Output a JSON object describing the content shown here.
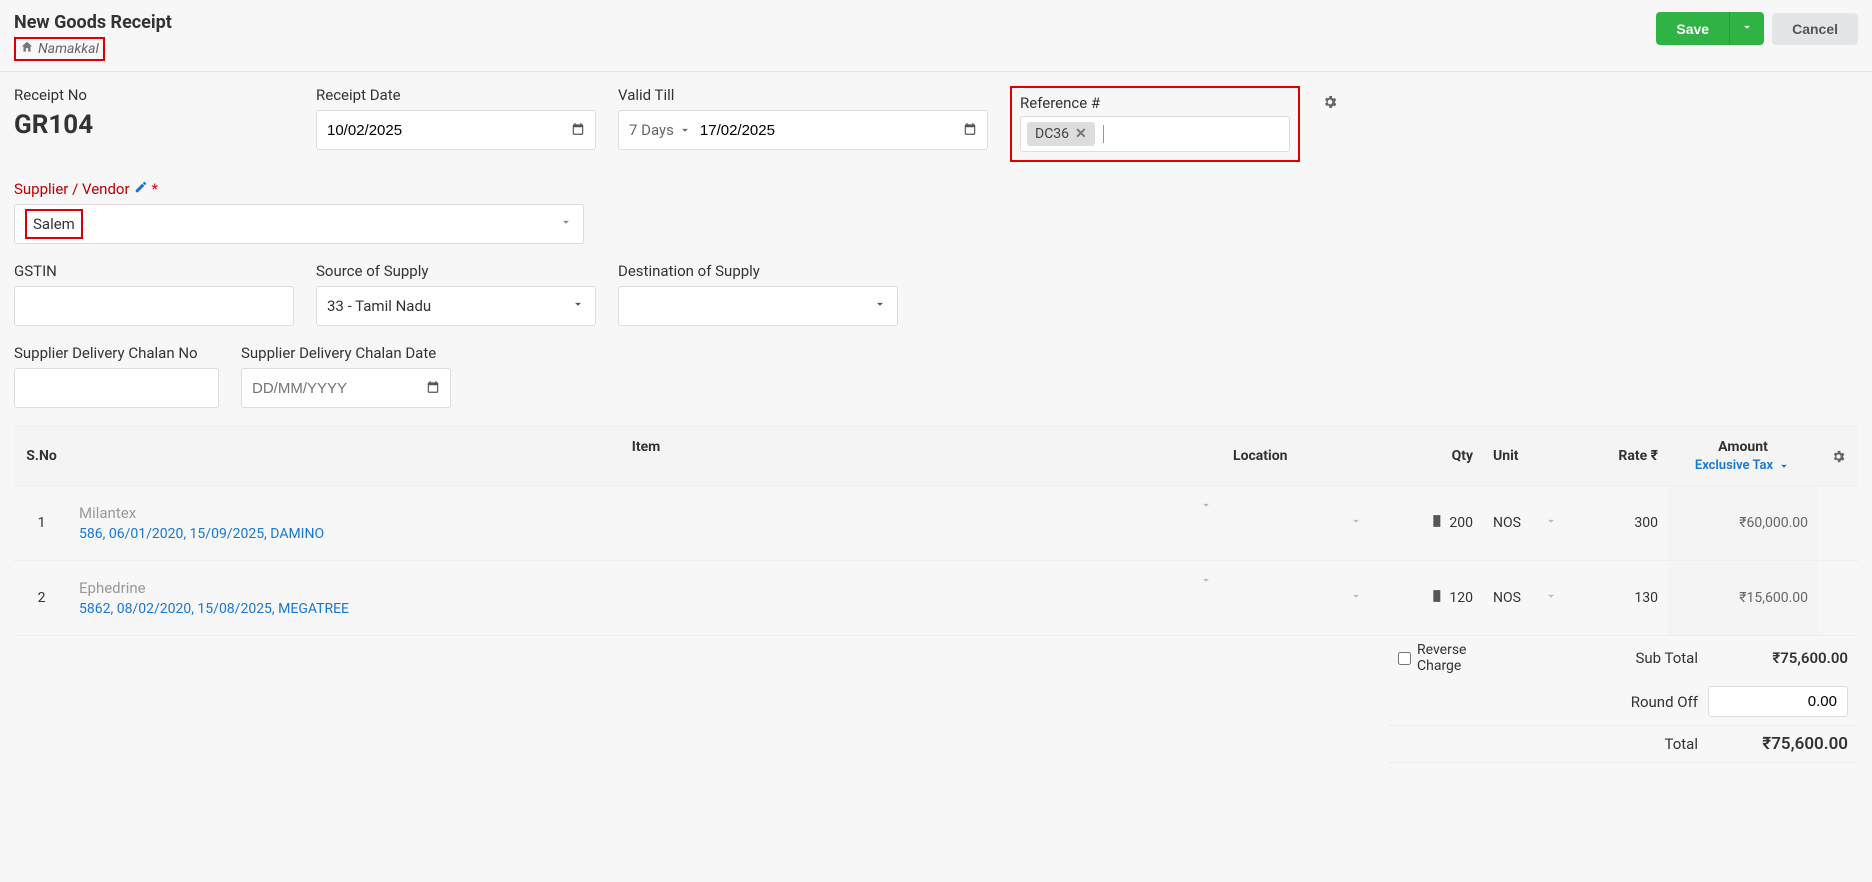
{
  "header": {
    "title": "New Goods Receipt",
    "home_label": "Namakkal",
    "save_label": "Save",
    "cancel_label": "Cancel"
  },
  "fields": {
    "receipt_no_label": "Receipt No",
    "receipt_no": "GR104",
    "receipt_date_label": "Receipt Date",
    "receipt_date": "10/02/2025",
    "valid_till_label": "Valid Till",
    "valid_till_days": "7 Days",
    "valid_till_date": "17/02/2025",
    "reference_label": "Reference #",
    "reference_tag": "DC36",
    "supplier_label": "Supplier / Vendor",
    "supplier_value": "Salem",
    "gstin_label": "GSTIN",
    "gstin_value": "",
    "source_label": "Source of Supply",
    "source_value": "33 - Tamil Nadu",
    "dest_label": "Destination of Supply",
    "dest_value": "",
    "sdc_no_label": "Supplier Delivery Chalan No",
    "sdc_no_value": "",
    "sdc_date_label": "Supplier Delivery Chalan Date",
    "sdc_date_placeholder": "DD/MM/YYYY"
  },
  "table": {
    "columns": {
      "sno": "S.No",
      "item": "Item",
      "location": "Location",
      "qty": "Qty",
      "unit": "Unit",
      "rate": "Rate ₹",
      "amount": "Amount",
      "tax_mode": "Exclusive Tax"
    },
    "rows": [
      {
        "sno": "1",
        "item": "Milantex",
        "meta": "586, 06/01/2020, 15/09/2025, DAMINO",
        "qty": "200",
        "unit": "NOS",
        "rate": "300",
        "amount": "₹60,000.00"
      },
      {
        "sno": "2",
        "item": "Ephedrine",
        "meta": "5862, 08/02/2020, 15/08/2025, MEGATREE",
        "qty": "120",
        "unit": "NOS",
        "rate": "130",
        "amount": "₹15,600.00"
      }
    ]
  },
  "totals": {
    "reverse_charge_label": "Reverse Charge",
    "subtotal_label": "Sub Total",
    "subtotal_value": "₹75,600.00",
    "roundoff_label": "Round Off",
    "roundoff_value": "0.00",
    "total_label": "Total",
    "total_value": "₹75,600.00"
  }
}
